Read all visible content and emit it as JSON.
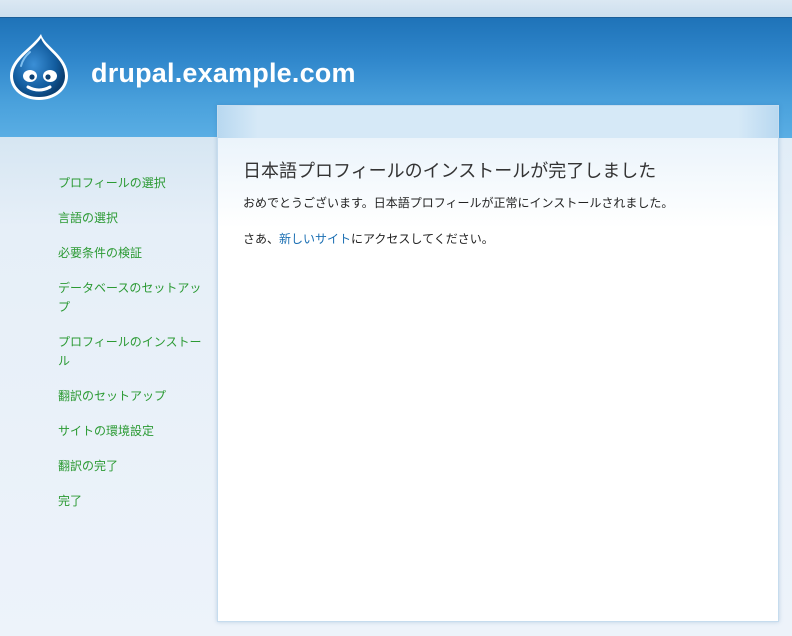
{
  "header": {
    "site_name": "drupal.example.com"
  },
  "sidebar": {
    "items": [
      {
        "label": "プロフィールの選択"
      },
      {
        "label": "言語の選択"
      },
      {
        "label": "必要条件の検証"
      },
      {
        "label": "データベースのセットアップ"
      },
      {
        "label": "プロフィールのインストール"
      },
      {
        "label": "翻訳のセットアップ"
      },
      {
        "label": "サイトの環境設定"
      },
      {
        "label": "翻訳の完了"
      },
      {
        "label": "完了"
      }
    ]
  },
  "main": {
    "title": "日本語プロフィールのインストールが完了しました",
    "congrats": "おめでとうございます。日本語プロフィールが正常にインストールされました。",
    "visit_prefix": "さあ、",
    "visit_link": "新しいサイト",
    "visit_suffix": "にアクセスしてください。"
  },
  "colors": {
    "header": "#2f86cb",
    "sidebar_link": "#2b9a33",
    "content_link": "#1b6fb3"
  },
  "icons": {
    "logo": "drupal-drop-icon"
  }
}
